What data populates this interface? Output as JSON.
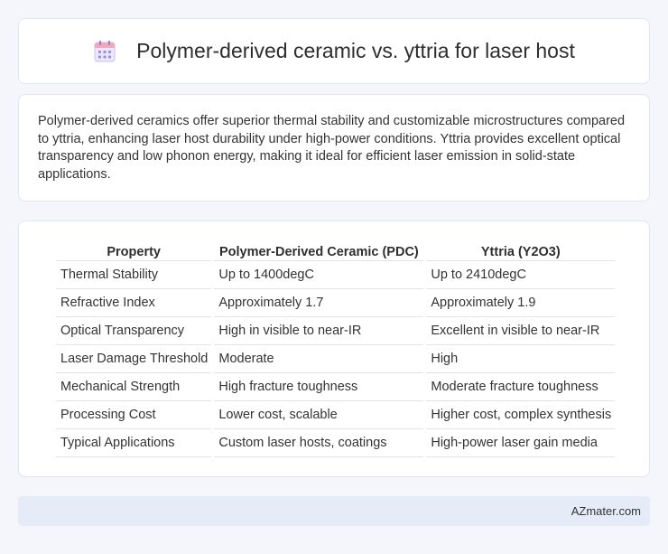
{
  "header": {
    "title": "Polymer-derived ceramic vs. yttria for laser host",
    "icon": "calendar-icon"
  },
  "summary": {
    "text": "Polymer-derived ceramics offer superior thermal stability and customizable microstructures compared to yttria, enhancing laser host durability under high-power conditions. Yttria provides excellent optical transparency and low phonon energy, making it ideal for efficient laser emission in solid-state applications."
  },
  "table": {
    "headers": [
      "Property",
      "Polymer-Derived Ceramic (PDC)",
      "Yttria (Y2O3)"
    ],
    "rows": [
      [
        "Thermal Stability",
        "Up to 1400degC",
        "Up to 2410degC"
      ],
      [
        "Refractive Index",
        "Approximately 1.7",
        "Approximately 1.9"
      ],
      [
        "Optical Transparency",
        "High in visible to near-IR",
        "Excellent in visible to near-IR"
      ],
      [
        "Laser Damage Threshold",
        "Moderate",
        "High"
      ],
      [
        "Mechanical Strength",
        "High fracture toughness",
        "Moderate fracture toughness"
      ],
      [
        "Processing Cost",
        "Lower cost, scalable",
        "Higher cost, complex synthesis"
      ],
      [
        "Typical Applications",
        "Custom laser hosts, coatings",
        "High-power laser gain media"
      ]
    ]
  },
  "footer": {
    "brand": "AZmater.com"
  },
  "colors": {
    "background": "#f4f6fb",
    "footer_bg": "#e6ecf7",
    "icon_accent": "#9b8ee6"
  }
}
